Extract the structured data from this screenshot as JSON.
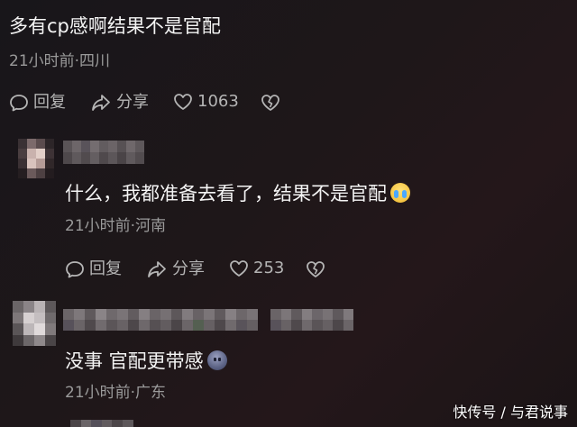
{
  "top_comment": {
    "text": "多有cp感啊结果不是官配",
    "meta": "21小时前·四川",
    "reply_label": "回复",
    "share_label": "分享",
    "like_count": "1063"
  },
  "reply_1": {
    "text": "什么，我都准备去看了，结果不是官配",
    "emoji": "crying-face-icon",
    "meta": "21小时前·河南",
    "reply_label": "回复",
    "share_label": "分享",
    "like_count": "253"
  },
  "reply_2": {
    "text": "没事 官配更带感",
    "emoji": "meh-face-icon",
    "meta": "21小时前·广东"
  },
  "watermark": "快传号 / 与君说事",
  "colors": {
    "text": "#f4f4f4",
    "meta": "#9a9a9a",
    "action": "#b5b5b5"
  }
}
